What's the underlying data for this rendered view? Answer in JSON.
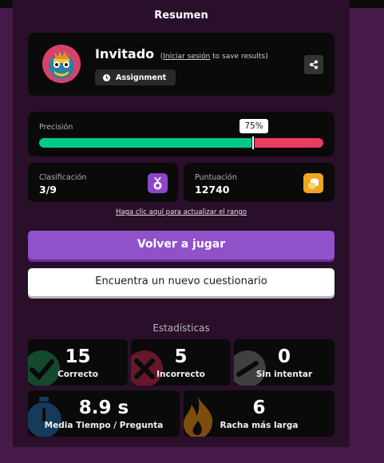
{
  "summary": {
    "title": "Resumen"
  },
  "user": {
    "name": "Invitado",
    "login_open": "(",
    "login_link": "Iniciar sesión",
    "login_rest": " to save results)",
    "badge_label": "Assignment"
  },
  "accuracy": {
    "label": "Precisión",
    "percent_text": "75%",
    "percent": 75,
    "correct_color": "#00c986",
    "incorrect_color": "#ec3b61"
  },
  "rank": {
    "label": "Clasificación",
    "value": "3/9",
    "icon": "medal-icon",
    "color": "#8d46c9"
  },
  "score": {
    "label": "Puntuación",
    "value": "12740",
    "icon": "coins-icon",
    "color": "#f3a41f"
  },
  "refresh_link": "Haga clic aquí para actualizar el rango",
  "buttons": {
    "play_again": "Volver a jugar",
    "new_quiz": "Encuentra un nuevo cuestionario"
  },
  "statistics": {
    "title": "Estadísticas",
    "correct": {
      "value": "15",
      "label": "Correcto",
      "icon": "check-icon",
      "color": "#1f7d4f"
    },
    "incorrect": {
      "value": "5",
      "label": "Incorrecto",
      "icon": "x-icon",
      "color": "#b0243f"
    },
    "unattempted": {
      "value": "0",
      "label": "Sin intentar",
      "icon": "dash-icon",
      "color": "#6e6e6e"
    },
    "avg_time": {
      "value": "8.9 s",
      "label": "Media Tiempo / Pregunta",
      "icon": "stopwatch-icon",
      "color": "#1c5a8f"
    },
    "streak": {
      "value": "6",
      "label": "Racha más larga",
      "icon": "flame-icon",
      "color": "#c97a10"
    }
  },
  "colors": {
    "background": "#461a48",
    "panel": "#2a0f2b",
    "card": "#0a0a0a",
    "primary_button": "#8f52c9"
  }
}
